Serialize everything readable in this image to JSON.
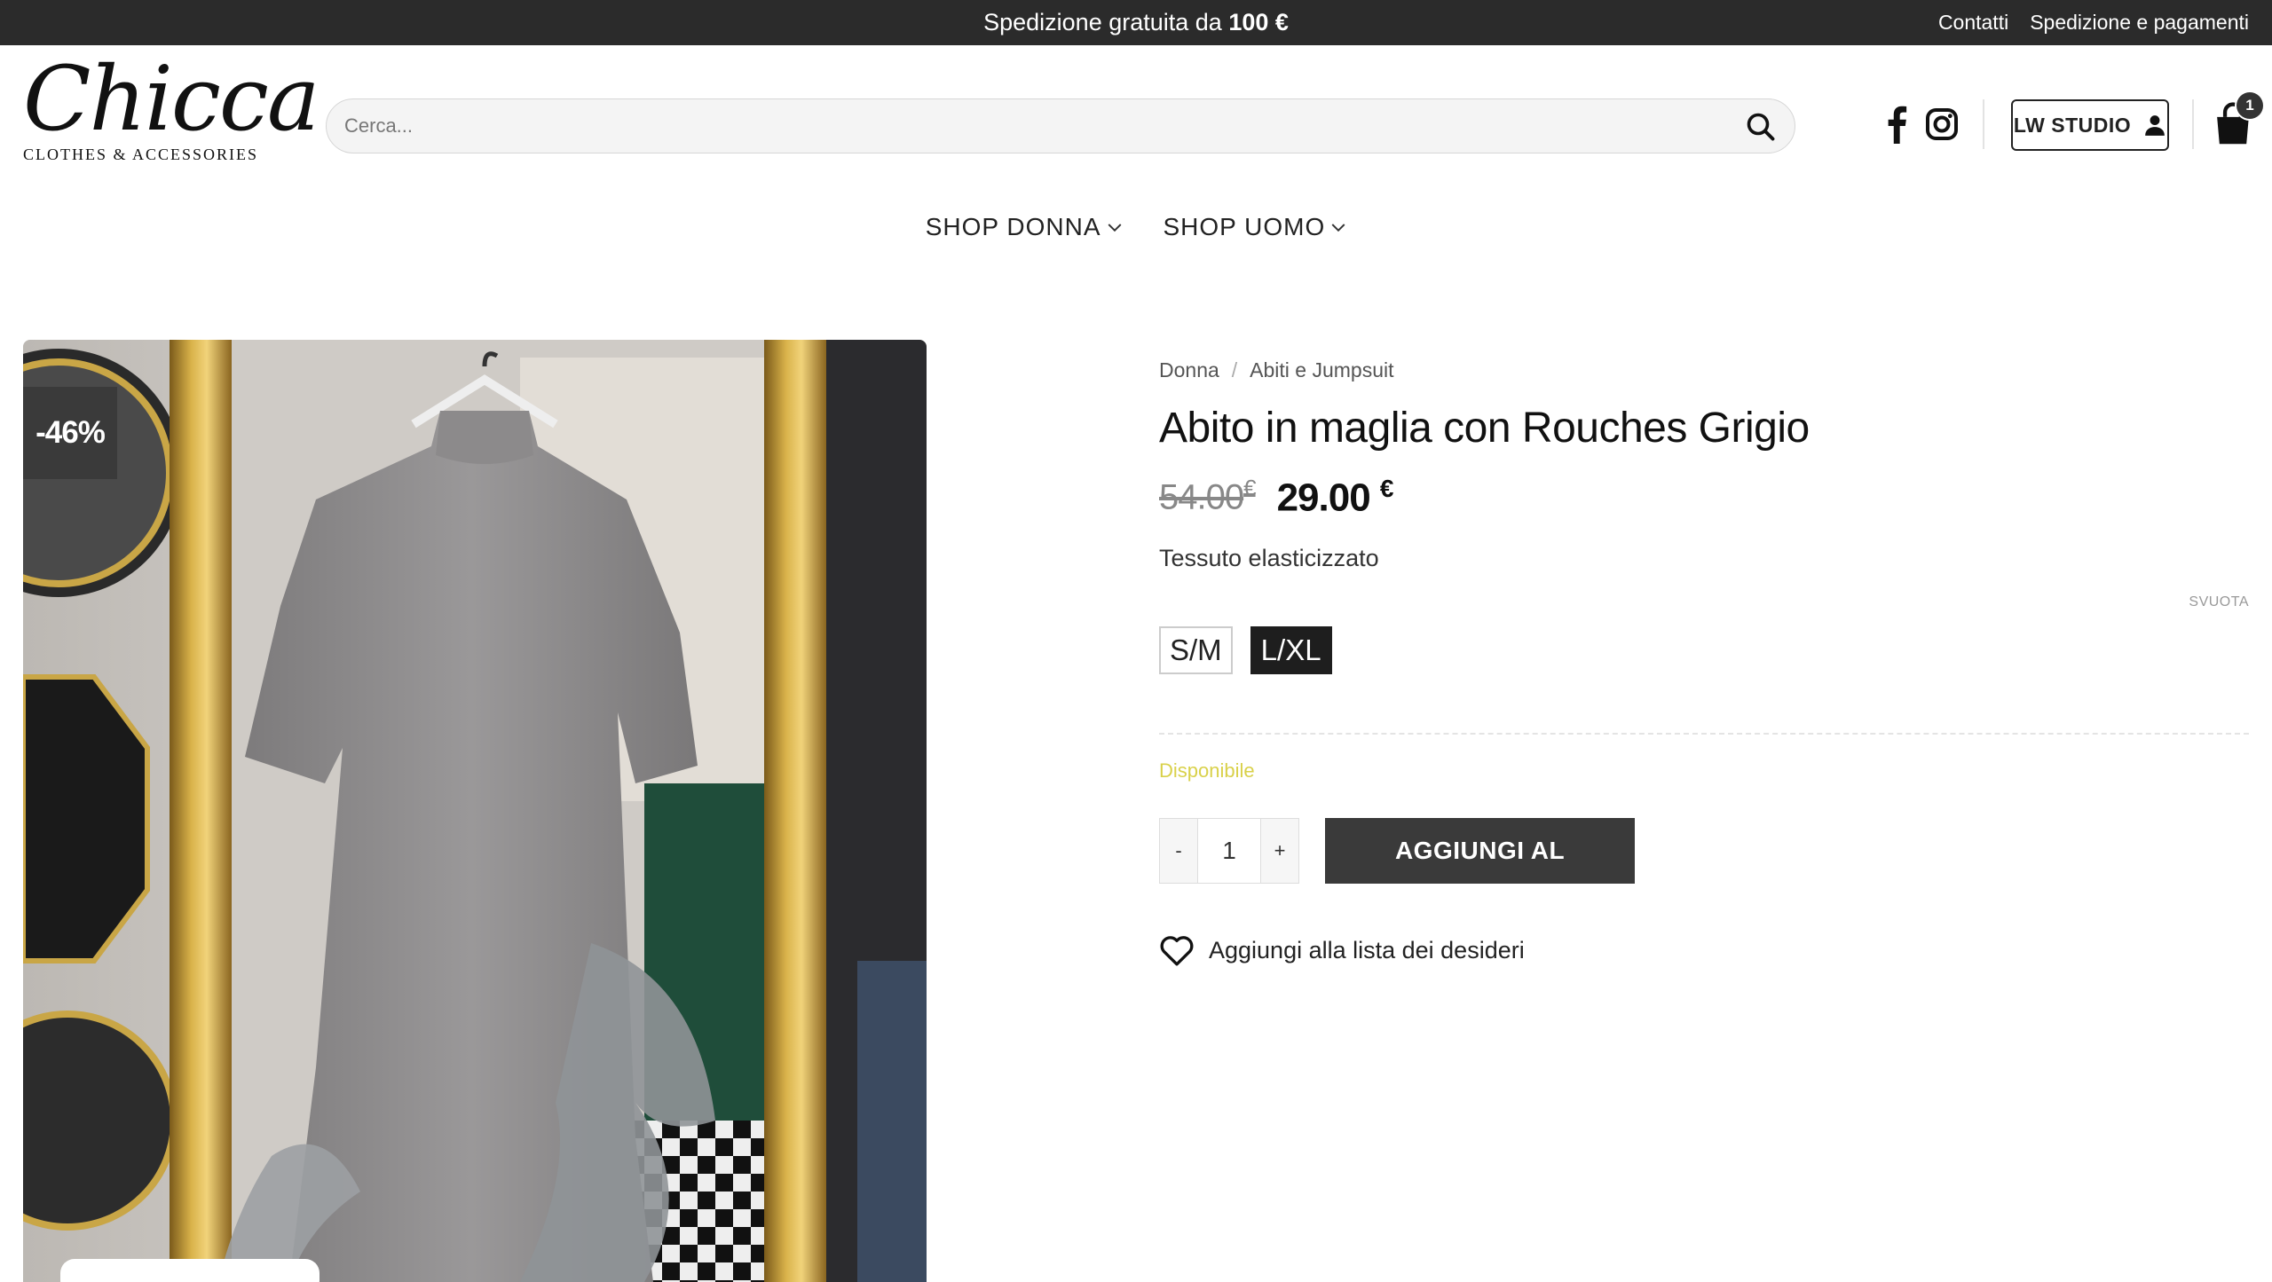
{
  "topbar": {
    "promo_text": "Spedizione gratuita da ",
    "promo_amount": "100 €",
    "links": [
      "Contatti",
      "Spedizione e pagamenti"
    ]
  },
  "logo": {
    "script": "Chicca",
    "tagline": "CLOTHES & ACCESSORIES"
  },
  "search": {
    "placeholder": "Cerca...",
    "value": ""
  },
  "account": {
    "label": "LW STUDIO"
  },
  "cart": {
    "count": "1"
  },
  "nav": {
    "items": [
      "SHOP DONNA",
      "SHOP UOMO"
    ]
  },
  "gallery": {
    "sale_badge": "-46%"
  },
  "product": {
    "breadcrumb": [
      "Donna",
      "Abiti e Jumpsuit"
    ],
    "title": "Abito in maglia con Rouches Grigio",
    "old_price": "54.00",
    "new_price": "29.00",
    "currency": "€",
    "description": "Tessuto elasticizzato",
    "clear_label": "SVUOTA",
    "sizes": [
      "S/M",
      "L/XL"
    ],
    "selected_size": "L/XL",
    "stock": "Disponibile",
    "quantity": "1",
    "qty_minus": "-",
    "qty_plus": "+",
    "add_to_cart": "AGGIUNGI AL CARRELLO",
    "wishlist": "Aggiungi alla lista dei desideri"
  },
  "colors": {
    "topbar": "#2b2b2b",
    "accent_dark": "#3a3a3a",
    "stock": "#d9d14a"
  }
}
